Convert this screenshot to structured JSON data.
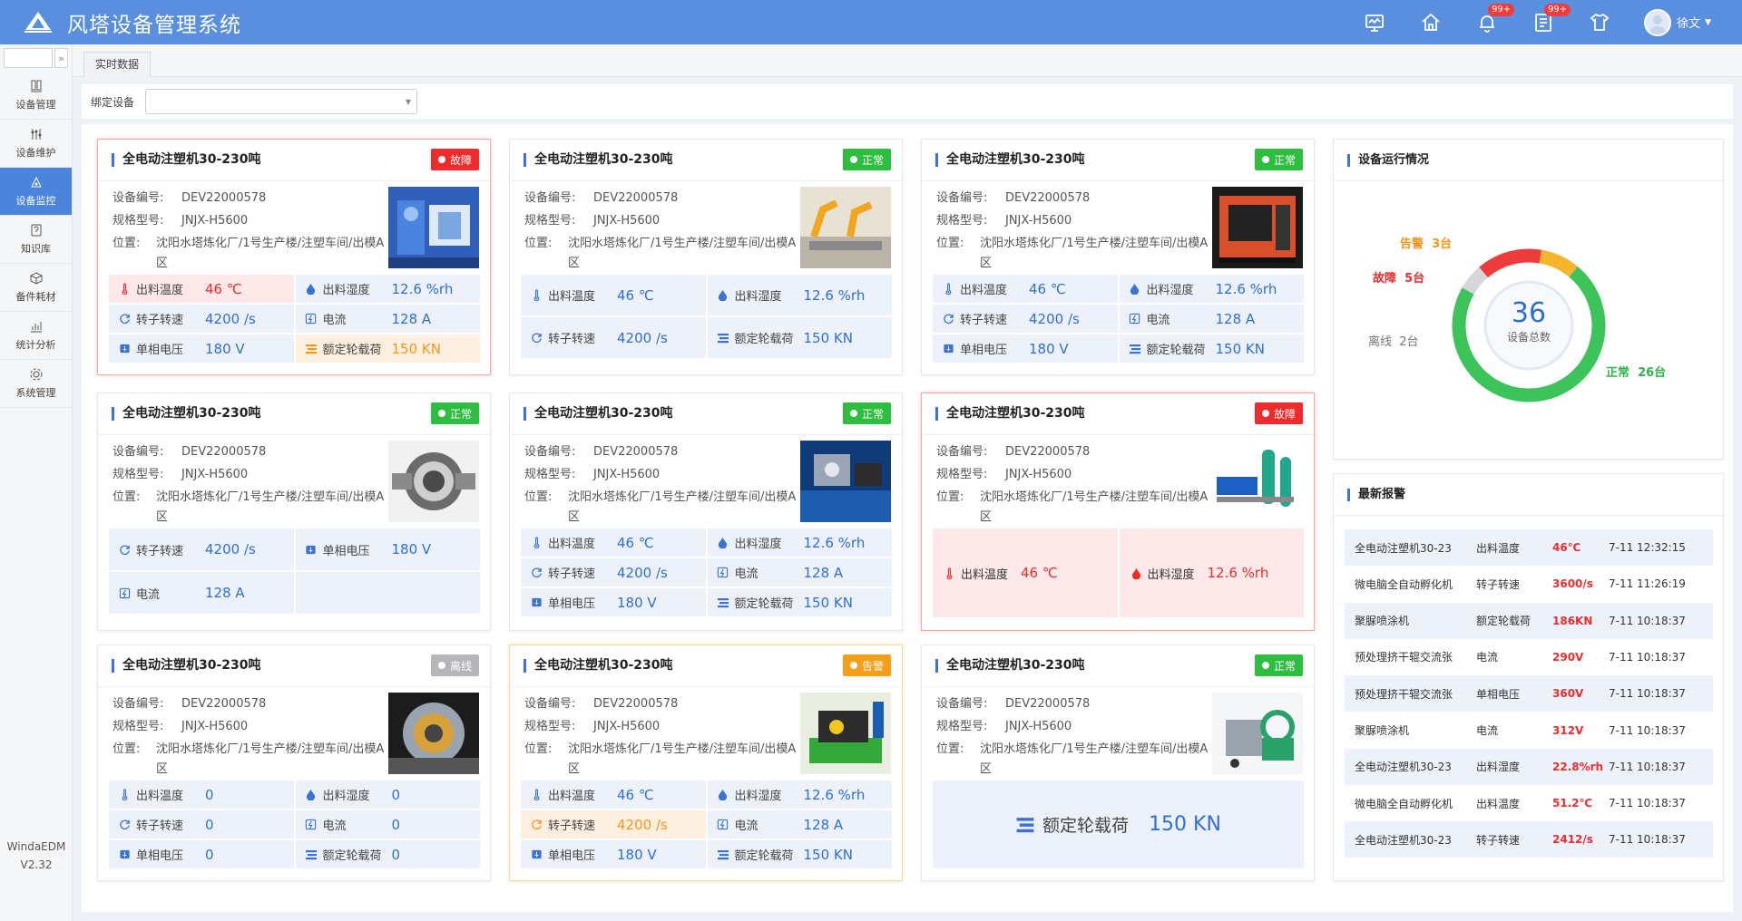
{
  "app": {
    "title": "风塔设备管理系统",
    "logo_text": "WindaEDM"
  },
  "topbar": {
    "badges": [
      "99+",
      "99+"
    ],
    "user": "徐文"
  },
  "sidebar": {
    "items": [
      "设备管理",
      "设备维护",
      "设备监控",
      "知识库",
      "备件耗材",
      "统计分析",
      "系统管理"
    ],
    "active": 2,
    "version_name": "WindaEDM",
    "version": "V2.32"
  },
  "tab": "实时数据",
  "filter": {
    "label": "绑定设备",
    "value": ""
  },
  "cards": [
    {
      "title": "全电动注塑机30-230吨",
      "status": "故障",
      "id_label": "设备编号:",
      "id": "DEV22000578",
      "model_label": "规格型号:",
      "model": "JNJX-H5600",
      "loc_label": "位置:",
      "loc": "沈阳水塔炼化厂/1号生产楼/注塑车间/出模A区",
      "metrics": [
        {
          "label": "出料温度",
          "value": "46 ℃",
          "state": "red",
          "icon": "thermo"
        },
        {
          "label": "出料湿度",
          "value": "12.6 %rh",
          "icon": "drop"
        },
        {
          "label": "转子转速",
          "value": "4200 /s",
          "icon": "rotate"
        },
        {
          "label": "电流",
          "value": "128 A",
          "icon": "current"
        },
        {
          "label": "单相电压",
          "value": "180 V",
          "icon": "voltage"
        },
        {
          "label": "额定轮载荷",
          "value": "150 KN",
          "state": "orange",
          "icon": "load"
        }
      ]
    },
    {
      "title": "全电动注塑机30-230吨",
      "status": "正常",
      "id_label": "设备编号:",
      "id": "DEV22000578",
      "model_label": "规格型号:",
      "model": "JNJX-H5600",
      "loc_label": "位置:",
      "loc": "沈阳水塔炼化厂/1号生产楼/注塑车间/出模A区",
      "metrics": [
        {
          "label": "出料温度",
          "value": "46 ℃",
          "icon": "thermo"
        },
        {
          "label": "出料湿度",
          "value": "12.6 %rh",
          "icon": "drop"
        },
        {
          "label": "转子转速",
          "value": "4200 /s",
          "icon": "rotate"
        },
        {
          "label": "额定轮载荷",
          "value": "150 KN",
          "icon": "load"
        }
      ]
    },
    {
      "title": "全电动注塑机30-230吨",
      "status": "正常",
      "id_label": "设备编号:",
      "id": "DEV22000578",
      "model_label": "规格型号:",
      "model": "JNJX-H5600",
      "loc_label": "位置:",
      "loc": "沈阳水塔炼化厂/1号生产楼/注塑车间/出模A区",
      "metrics": [
        {
          "label": "出料温度",
          "value": "46 ℃",
          "icon": "thermo"
        },
        {
          "label": "出料湿度",
          "value": "12.6 %rh",
          "icon": "drop"
        },
        {
          "label": "转子转速",
          "value": "4200 /s",
          "icon": "rotate"
        },
        {
          "label": "电流",
          "value": "128 A",
          "icon": "current"
        },
        {
          "label": "单相电压",
          "value": "180 V",
          "icon": "voltage"
        },
        {
          "label": "额定轮载荷",
          "value": "150 KN",
          "icon": "load"
        }
      ]
    },
    {
      "title": "全电动注塑机30-230吨",
      "status": "正常",
      "id_label": "设备编号:",
      "id": "DEV22000578",
      "model_label": "规格型号:",
      "model": "JNJX-H5600",
      "loc_label": "位置:",
      "loc": "沈阳水塔炼化厂/1号生产楼/注塑车间/出模A区",
      "metrics": [
        {
          "label": "转子转速",
          "value": "4200 /s",
          "icon": "rotate"
        },
        {
          "label": "单相电压",
          "value": "180 V",
          "icon": "voltage"
        },
        {
          "label": "电流",
          "value": "128 A",
          "icon": "current"
        }
      ]
    },
    {
      "title": "全电动注塑机30-230吨",
      "status": "正常",
      "id_label": "设备编号:",
      "id": "DEV22000578",
      "model_label": "规格型号:",
      "model": "JNJX-H5600",
      "loc_label": "位置:",
      "loc": "沈阳水塔炼化厂/1号生产楼/注塑车间/出模A区",
      "metrics": [
        {
          "label": "出料温度",
          "value": "46 ℃",
          "icon": "thermo"
        },
        {
          "label": "出料湿度",
          "value": "12.6 %rh",
          "icon": "drop"
        },
        {
          "label": "转子转速",
          "value": "4200 /s",
          "icon": "rotate"
        },
        {
          "label": "电流",
          "value": "128 A",
          "icon": "current"
        },
        {
          "label": "单相电压",
          "value": "180 V",
          "icon": "voltage"
        },
        {
          "label": "额定轮载荷",
          "value": "150 KN",
          "icon": "load"
        }
      ]
    },
    {
      "title": "全电动注塑机30-230吨",
      "status": "故障",
      "id_label": "设备编号:",
      "id": "DEV22000578",
      "model_label": "规格型号:",
      "model": "JNJX-H5600",
      "loc_label": "位置:",
      "loc": "沈阳水塔炼化厂/1号生产楼/注塑车间/出模A区",
      "metrics": [
        {
          "label": "出料温度",
          "value": "46 ℃",
          "icon": "thermo"
        },
        {
          "label": "出料湿度",
          "value": "12.6 %rh",
          "icon": "drop"
        }
      ]
    },
    {
      "title": "全电动注塑机30-230吨",
      "status": "离线",
      "id_label": "设备编号:",
      "id": "DEV22000578",
      "model_label": "规格型号:",
      "model": "JNJX-H5600",
      "loc_label": "位置:",
      "loc": "沈阳水塔炼化厂/1号生产楼/注塑车间/出模A区",
      "metrics": [
        {
          "label": "出料温度",
          "value": "0",
          "icon": "thermo"
        },
        {
          "label": "出料湿度",
          "value": "0",
          "icon": "drop"
        },
        {
          "label": "转子转速",
          "value": "0",
          "icon": "rotate"
        },
        {
          "label": "电流",
          "value": "0",
          "icon": "current"
        },
        {
          "label": "单相电压",
          "value": "0",
          "icon": "voltage"
        },
        {
          "label": "额定轮载荷",
          "value": "0",
          "icon": "load"
        }
      ]
    },
    {
      "title": "全电动注塑机30-230吨",
      "status": "告警",
      "id_label": "设备编号:",
      "id": "DEV22000578",
      "model_label": "规格型号:",
      "model": "JNJX-H5600",
      "loc_label": "位置:",
      "loc": "沈阳水塔炼化厂/1号生产楼/注塑车间/出模A区",
      "metrics": [
        {
          "label": "出料温度",
          "value": "46 ℃",
          "icon": "thermo"
        },
        {
          "label": "出料湿度",
          "value": "12.6 %rh",
          "icon": "drop"
        },
        {
          "label": "转子转速",
          "value": "4200 /s",
          "state": "orange",
          "icon": "rotate"
        },
        {
          "label": "电流",
          "value": "128 A",
          "icon": "current"
        },
        {
          "label": "单相电压",
          "value": "180 V",
          "icon": "voltage"
        },
        {
          "label": "额定轮载荷",
          "value": "150 KN",
          "icon": "load"
        }
      ]
    },
    {
      "title": "全电动注塑机30-230吨",
      "status": "正常",
      "id_label": "设备编号:",
      "id": "DEV22000578",
      "model_label": "规格型号:",
      "model": "JNJX-H5600",
      "loc_label": "位置:",
      "loc": "沈阳水塔炼化厂/1号生产楼/注塑车间/出模A区",
      "metrics": [
        {
          "label": "额定轮载荷",
          "value": "150 KN",
          "icon": "load"
        }
      ]
    }
  ],
  "status_colors": {
    "正常": "#2dbd3f",
    "故障": "#ee2a2a",
    "离线": "#b4b6ba",
    "告警": "#f59e17"
  },
  "running": {
    "title": "设备运行情况",
    "total": "36",
    "total_label": "设备总数",
    "segments": [
      {
        "name": "正常",
        "value": 26,
        "text": "26台",
        "color": "#3cc45a"
      },
      {
        "name": "离线",
        "value": 2,
        "text": "2台",
        "color": "#d5d7db"
      },
      {
        "name": "故障",
        "value": 5,
        "text": "5台",
        "color": "#ee3b3b"
      },
      {
        "name": "告警",
        "value": 3,
        "text": "3台",
        "color": "#f6b52d"
      }
    ]
  },
  "alarms": {
    "title": "最新报警",
    "rows": [
      {
        "name": "全电动注塑机30-23",
        "param": "出料温度",
        "value": "46℃",
        "time": "7-11 12:32:15"
      },
      {
        "name": "微电脑全自动孵化机",
        "param": "转子转速",
        "value": "3600/s",
        "time": "7-11 11:26:19"
      },
      {
        "name": "聚脲喷涂机",
        "param": "额定轮载荷",
        "value": "186KN",
        "time": "7-11 10:18:37"
      },
      {
        "name": "预处理挤干辊交流张",
        "param": "电流",
        "value": "290V",
        "time": "7-11 10:18:37"
      },
      {
        "name": "预处理挤干辊交流张",
        "param": "单相电压",
        "value": "360V",
        "time": "7-11 10:18:37"
      },
      {
        "name": "聚脲喷涂机",
        "param": "电流",
        "value": "312V",
        "time": "7-11 10:18:37"
      },
      {
        "name": "全电动注塑机30-23",
        "param": "出料湿度",
        "value": "22.8%rh",
        "time": "7-11 10:18:37"
      },
      {
        "name": "微电脑全自动孵化机",
        "param": "出料温度",
        "value": "51.2℃",
        "time": "7-11 10:18:37"
      },
      {
        "name": "全电动注塑机30-23",
        "param": "转子转速",
        "value": "2412/s",
        "time": "7-11 10:18:37"
      }
    ]
  }
}
